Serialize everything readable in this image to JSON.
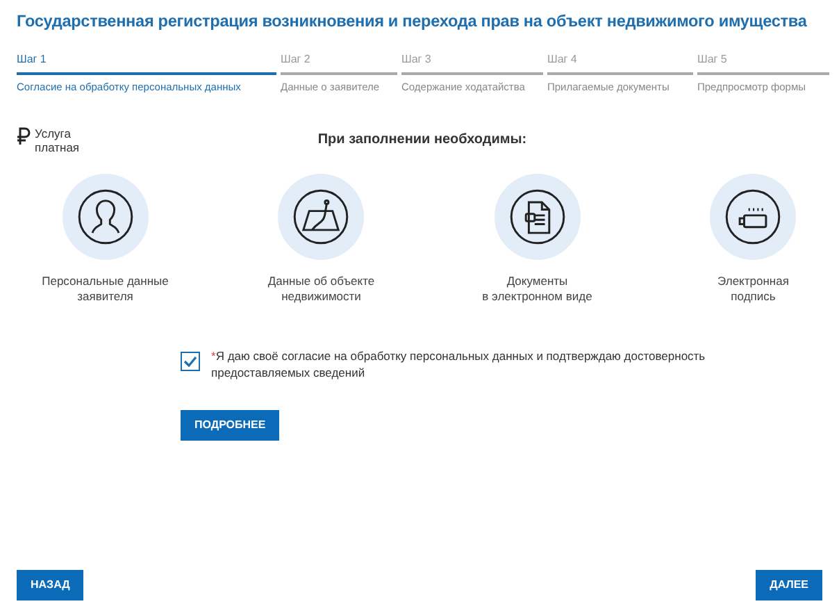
{
  "window": {
    "title": "Государственная регистрация возникновения и перехода прав на объект недвижимого имущества"
  },
  "steps": [
    {
      "label": "Шаг 1",
      "name": "Согласие на обработку персональных данных",
      "selected": true
    },
    {
      "label": "Шаг 2",
      "name": "Данные о заявителе",
      "selected": false
    },
    {
      "label": "Шаг 3",
      "name": "Содержание ходатайства",
      "selected": false
    },
    {
      "label": "Шаг 4",
      "name": "Прилагаемые документы",
      "selected": false
    },
    {
      "label": "Шаг 5",
      "name": "Предпросмотр формы",
      "selected": false
    }
  ],
  "fee": {
    "text": "Услуга платная"
  },
  "requirements": {
    "heading": "При заполнении необходимы:",
    "items": [
      {
        "kind": "person",
        "line1": "Персональные данные",
        "line2": "заявителя"
      },
      {
        "kind": "map",
        "line1": "Данные об объекте",
        "line2": "недвижимости"
      },
      {
        "kind": "document",
        "line1": "Документы",
        "line2": "в электронном виде"
      },
      {
        "kind": "key",
        "line1": "Электронная",
        "line2": "подпись"
      }
    ]
  },
  "consent": {
    "checked": true,
    "required_mark": "*",
    "text": "Я даю своё согласие на обработку персональных данных и подтверждаю достоверность предоставляемых сведений"
  },
  "buttons": {
    "more": "ПОДРОБНЕЕ",
    "back": "НАЗАД",
    "next": "ДАЛЕЕ"
  }
}
